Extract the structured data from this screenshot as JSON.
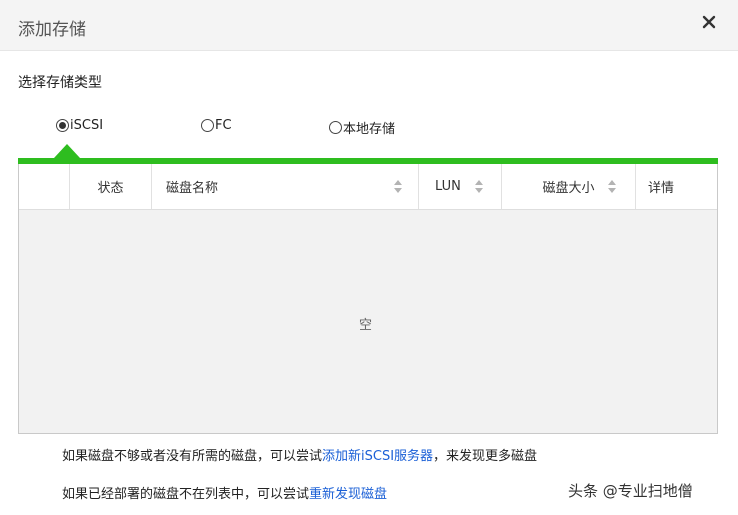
{
  "dialog": {
    "title": "添加存储",
    "close_symbol": "×"
  },
  "storage_type": {
    "label": "选择存储类型",
    "options": [
      {
        "label": "iSCSI",
        "checked": true
      },
      {
        "label": "FC",
        "checked": false
      },
      {
        "label": "本地存储",
        "checked": false
      }
    ]
  },
  "table": {
    "columns": [
      "状态",
      "磁盘名称",
      "LUN",
      "磁盘大小",
      "详情"
    ],
    "rows": [],
    "empty_text": "空"
  },
  "notes": {
    "line1_prefix": "如果磁盘不够或者没有所需的磁盘，可以尝试",
    "line1_link": "添加新iSCSI服务器",
    "line1_suffix": "，来发现更多磁盘",
    "line2_prefix": "如果已经部署的磁盘不在列表中，可以尝试",
    "line2_link": "重新发现磁盘"
  },
  "watermark": "头条 @专业扫地僧",
  "colors": {
    "accent_green": "#2ebd1f",
    "link_blue": "#1a5fd6"
  }
}
